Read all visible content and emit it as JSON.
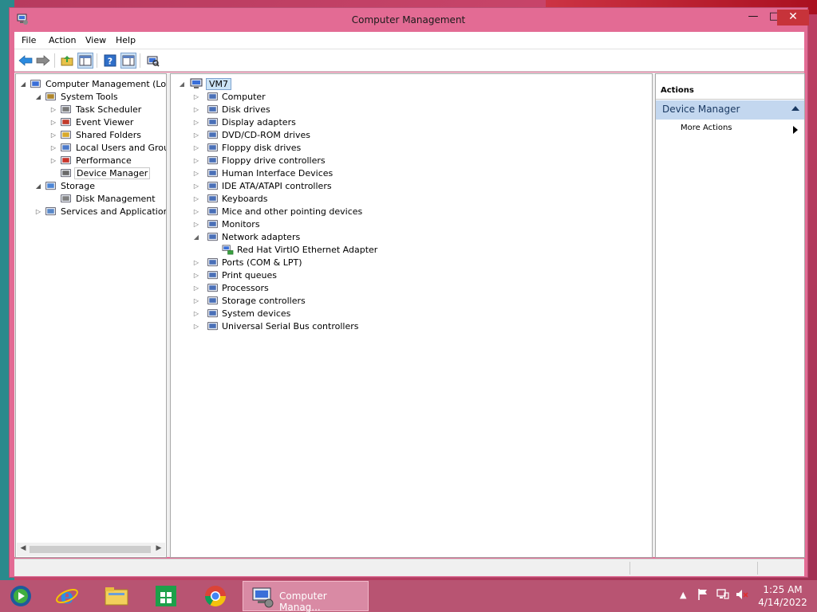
{
  "window": {
    "title": "Computer Management"
  },
  "menu": [
    "File",
    "Action",
    "View",
    "Help"
  ],
  "left_tree": [
    {
      "label": "Computer Management (Local",
      "depth": 0,
      "expand": "open",
      "icon": "computer-management-icon"
    },
    {
      "label": "System Tools",
      "depth": 1,
      "expand": "open",
      "icon": "system-tools-icon"
    },
    {
      "label": "Task Scheduler",
      "depth": 2,
      "expand": "closed",
      "icon": "task-scheduler-icon"
    },
    {
      "label": "Event Viewer",
      "depth": 2,
      "expand": "closed",
      "icon": "event-viewer-icon"
    },
    {
      "label": "Shared Folders",
      "depth": 2,
      "expand": "closed",
      "icon": "shared-folders-icon"
    },
    {
      "label": "Local Users and Groups",
      "depth": 2,
      "expand": "closed",
      "icon": "local-users-icon"
    },
    {
      "label": "Performance",
      "depth": 2,
      "expand": "closed",
      "icon": "performance-icon"
    },
    {
      "label": "Device Manager",
      "depth": 2,
      "expand": "none",
      "icon": "device-manager-icon",
      "selected": true
    },
    {
      "label": "Storage",
      "depth": 1,
      "expand": "open",
      "icon": "storage-icon"
    },
    {
      "label": "Disk Management",
      "depth": 2,
      "expand": "none",
      "icon": "disk-management-icon"
    },
    {
      "label": "Services and Applications",
      "depth": 1,
      "expand": "closed",
      "icon": "services-icon"
    }
  ],
  "device_tree": {
    "root": "VM7",
    "categories": [
      {
        "label": "Computer",
        "expand": "closed",
        "icon": "computer-icon"
      },
      {
        "label": "Disk drives",
        "expand": "closed",
        "icon": "disk-drive-icon"
      },
      {
        "label": "Display adapters",
        "expand": "closed",
        "icon": "display-adapter-icon"
      },
      {
        "label": "DVD/CD-ROM drives",
        "expand": "closed",
        "icon": "dvd-drive-icon"
      },
      {
        "label": "Floppy disk drives",
        "expand": "closed",
        "icon": "floppy-disk-icon"
      },
      {
        "label": "Floppy drive controllers",
        "expand": "closed",
        "icon": "floppy-controller-icon"
      },
      {
        "label": "Human Interface Devices",
        "expand": "closed",
        "icon": "hid-icon"
      },
      {
        "label": "IDE ATA/ATAPI controllers",
        "expand": "closed",
        "icon": "ide-controller-icon"
      },
      {
        "label": "Keyboards",
        "expand": "closed",
        "icon": "keyboard-icon"
      },
      {
        "label": "Mice and other pointing devices",
        "expand": "closed",
        "icon": "mouse-icon"
      },
      {
        "label": "Monitors",
        "expand": "closed",
        "icon": "monitor-icon"
      },
      {
        "label": "Network adapters",
        "expand": "open",
        "icon": "network-adapter-icon",
        "children": [
          "Red Hat VirtIO Ethernet Adapter"
        ]
      },
      {
        "label": "Ports (COM & LPT)",
        "expand": "closed",
        "icon": "ports-icon"
      },
      {
        "label": "Print queues",
        "expand": "closed",
        "icon": "printer-icon"
      },
      {
        "label": "Processors",
        "expand": "closed",
        "icon": "processor-icon"
      },
      {
        "label": "Storage controllers",
        "expand": "closed",
        "icon": "storage-controller-icon"
      },
      {
        "label": "System devices",
        "expand": "closed",
        "icon": "system-devices-icon"
      },
      {
        "label": "Universal Serial Bus controllers",
        "expand": "closed",
        "icon": "usb-icon"
      }
    ]
  },
  "actions": {
    "header": "Actions",
    "section": "Device Manager",
    "items": [
      "More Actions"
    ]
  },
  "taskbar": {
    "active_label": "Computer Manag...",
    "time": "1:25 AM",
    "date": "4/14/2022"
  },
  "colors": {
    "titlebar": "#e36b94",
    "taskbar": "#b85472",
    "close": "#c7333a",
    "selection": "#cce4f7",
    "action_section": "#c3d7ef"
  }
}
